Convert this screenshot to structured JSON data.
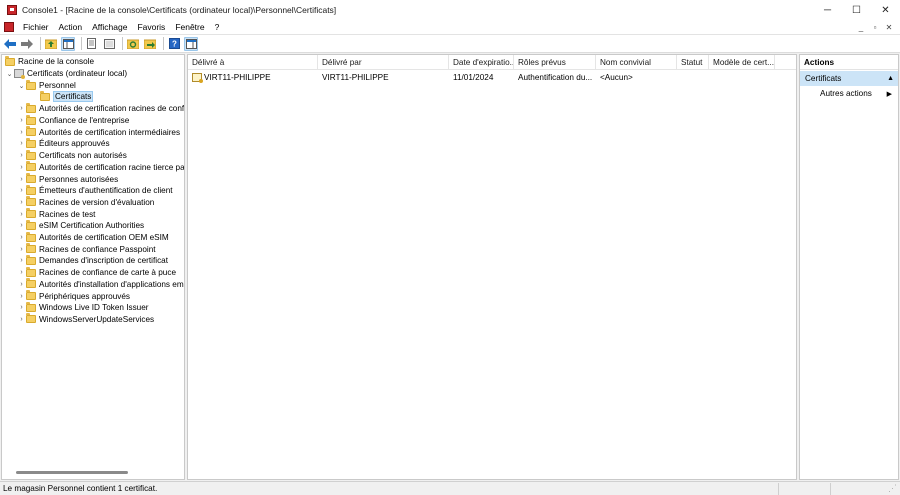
{
  "window": {
    "title": "Console1 - [Racine de la console\\Certificats (ordinateur local)\\Personnel\\Certificats]",
    "minimize": "─",
    "maximize": "☐",
    "close": "✕"
  },
  "menu": {
    "items": [
      "Fichier",
      "Action",
      "Affichage",
      "Favoris",
      "Fenêtre",
      "?"
    ],
    "mdi": [
      "_",
      "▫",
      "✕"
    ]
  },
  "toolbar": {
    "icons": [
      "back-icon",
      "forward-icon",
      "up-folder-icon",
      "show-hide-tree-icon",
      "copy-icon",
      "properties-icon",
      "refresh-icon",
      "export-icon",
      "help-icon",
      "show-hide-action-pane-icon"
    ]
  },
  "tree": {
    "root": "Racine de la console",
    "computer": "Certificats (ordinateur local)",
    "personnel": "Personnel",
    "certificats": "Certificats",
    "stores": [
      "Autorités de certification racines de confi",
      "Confiance de l'entreprise",
      "Autorités de certification intermédiaires",
      "Éditeurs approuvés",
      "Certificats non autorisés",
      "Autorités de certification racine tierce par",
      "Personnes autorisées",
      "Émetteurs d'authentification de client",
      "Racines de version d'évaluation",
      "Racines de test",
      "eSIM Certification Authorities",
      "Autorités de certification OEM eSIM",
      "Racines de confiance Passpoint",
      "Demandes d'inscription de certificat",
      "Racines de confiance de carte à puce",
      "Autorités d'installation d'applications em",
      "Périphériques approuvés",
      "Windows Live ID Token Issuer",
      "WindowsServerUpdateServices"
    ]
  },
  "list": {
    "columns": [
      "Délivré à",
      "Délivré par",
      "Date d'expiratio...",
      "Rôles prévus",
      "Nom convivial",
      "Statut",
      "Modèle de cert..."
    ],
    "rows": [
      {
        "issued_to": "VIRT11-PHILIPPE",
        "issued_by": "VIRT11-PHILIPPE",
        "expiration": "11/01/2024",
        "roles": "Authentification du...",
        "friendly": "<Aucun>",
        "status": "",
        "template": ""
      }
    ]
  },
  "actions": {
    "title": "Actions",
    "section": "Certificats",
    "items": [
      "Autres actions"
    ]
  },
  "status": {
    "text": "Le magasin Personnel contient 1 certificat."
  },
  "colors": {
    "selection": "#cce4f7",
    "folder": "#f5cf63"
  }
}
